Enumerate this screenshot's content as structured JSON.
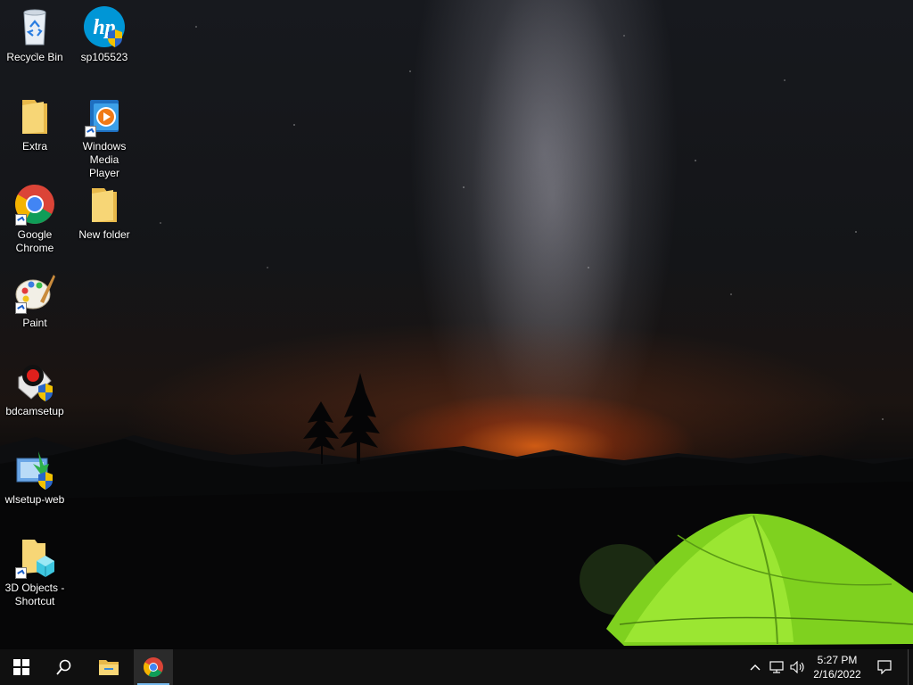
{
  "desktop_icons": [
    {
      "id": "recycle-bin",
      "label": "Recycle Bin",
      "icon": "recycle-bin-icon"
    },
    {
      "id": "sp105523",
      "label": "sp105523",
      "icon": "hp-logo-icon"
    },
    {
      "id": "extra",
      "label": "Extra",
      "icon": "folder-icon"
    },
    {
      "id": "windows-media-player",
      "label": "Windows Media Player",
      "icon": "media-player-icon"
    },
    {
      "id": "google-chrome",
      "label": "Google Chrome",
      "icon": "chrome-icon"
    },
    {
      "id": "new-folder",
      "label": "New folder",
      "icon": "folder-icon"
    },
    {
      "id": "paint",
      "label": "Paint",
      "icon": "paint-icon"
    },
    {
      "id": "bdcamsetup",
      "label": "bdcamsetup",
      "icon": "bdcam-icon"
    },
    {
      "id": "wlsetup-web",
      "label": "wlsetup-web",
      "icon": "installer-icon"
    },
    {
      "id": "3d-objects-shortcut",
      "label": "3D Objects - Shortcut",
      "icon": "3d-objects-folder-icon"
    }
  ],
  "taskbar": {
    "start": "windows-logo-icon",
    "search": "search-icon",
    "pinned": [
      {
        "name": "file-explorer",
        "icon": "folder-icon"
      },
      {
        "name": "google-chrome",
        "icon": "chrome-icon",
        "active": true
      }
    ],
    "tray": {
      "icons": [
        "chevron-up-icon",
        "network-icon",
        "volume-icon"
      ],
      "time": "5:27 PM",
      "date": "2/16/2022",
      "notifications": "action-center-icon"
    }
  },
  "colors": {
    "taskbar": "#101010",
    "accent": "#76b9ed",
    "tent": "#8ee02a"
  }
}
